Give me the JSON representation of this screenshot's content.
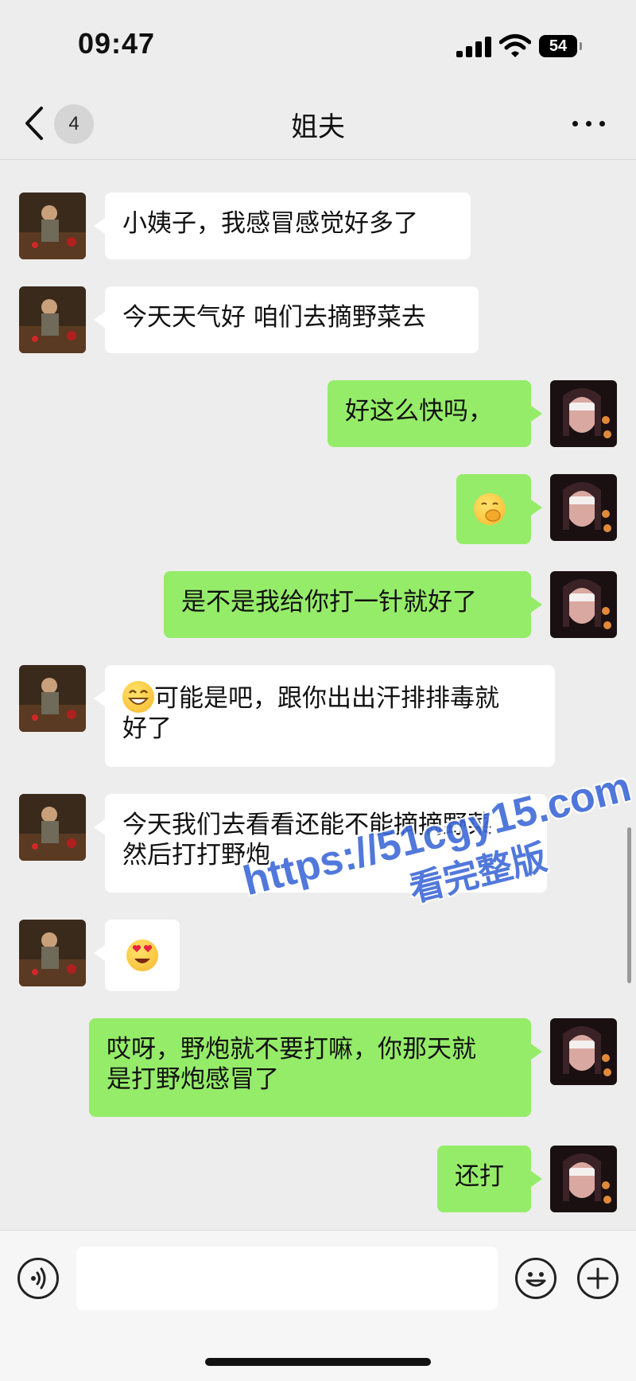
{
  "status_bar": {
    "time": "09:47",
    "battery_level": "54"
  },
  "nav": {
    "unread_count": "4",
    "title": "姐夫"
  },
  "messages": [
    {
      "side": "in",
      "text": "小姨子，我感冒感觉好多了"
    },
    {
      "side": "in",
      "text": "今天天气好 咱们去摘野菜去"
    },
    {
      "side": "out",
      "text": "好这么快吗，"
    },
    {
      "side": "out",
      "emoji": "hand-over-mouth-emoji"
    },
    {
      "side": "out",
      "text": "是不是我给你打一针就好了"
    },
    {
      "side": "in",
      "emoji": "grinning-emoji",
      "line1": "可能是吧，跟你出出汗排排毒就",
      "line2": "好了"
    },
    {
      "side": "in",
      "line1": "今天我们去看看还能不能摘摘野菜",
      "line2": "然后打打野炮"
    },
    {
      "side": "in",
      "emoji": "heart-eyes-emoji"
    },
    {
      "side": "out",
      "line1": "哎呀，野炮就不要打嘛，你那天就",
      "line2": "是打野炮感冒了"
    },
    {
      "side": "out",
      "text": "还打"
    }
  ],
  "watermark": {
    "url": "https://51cgy15.com",
    "subtitle": "看完整版"
  },
  "input_bar": {
    "placeholder": ""
  },
  "colors": {
    "background": "#ededed",
    "outgoing_bubble": "#95ec69",
    "incoming_bubble": "#ffffff",
    "watermark": "#3f6ad8"
  }
}
